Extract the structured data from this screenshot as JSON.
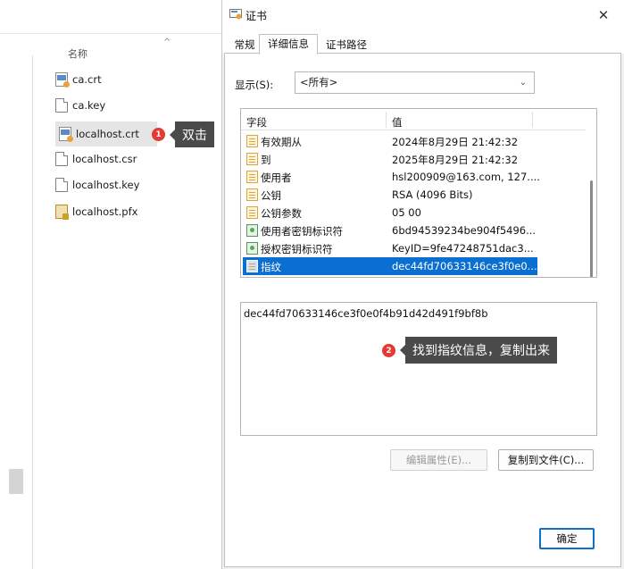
{
  "explorer": {
    "column_name": "名称",
    "files": [
      {
        "name": "ca.crt",
        "icon": "certificate-icon"
      },
      {
        "name": "ca.key",
        "icon": "file-icon"
      },
      {
        "name": "localhost.crt",
        "icon": "certificate-icon"
      },
      {
        "name": "localhost.csr",
        "icon": "file-icon"
      },
      {
        "name": "localhost.key",
        "icon": "file-icon"
      },
      {
        "name": "localhost.pfx",
        "icon": "pfx-icon"
      }
    ]
  },
  "annotations": {
    "step1_number": "1",
    "step1_text": "双击",
    "step2_number": "2",
    "step2_text": "找到指纹信息，复制出来"
  },
  "dialog": {
    "title": "证书",
    "close": "✕",
    "tabs": [
      {
        "label": "常规",
        "active": false
      },
      {
        "label": "详细信息",
        "active": true
      },
      {
        "label": "证书路径",
        "active": false
      }
    ],
    "show_label": "显示(S):",
    "show_value": "<所有>",
    "list_header": {
      "field": "字段",
      "value": "值"
    },
    "rows": [
      {
        "field": "有效期从",
        "value": "2024年8月29日 21:42:32",
        "icon": "orange"
      },
      {
        "field": "到",
        "value": "2025年8月29日 21:42:32",
        "icon": "orange"
      },
      {
        "field": "使用者",
        "value": "hsl200909@163.com, 127....",
        "icon": "orange"
      },
      {
        "field": "公钥",
        "value": "RSA (4096 Bits)",
        "icon": "orange"
      },
      {
        "field": "公钥参数",
        "value": "05 00",
        "icon": "orange"
      },
      {
        "field": "使用者密钥标识符",
        "value": "6bd94539234be904f5496...",
        "icon": "green"
      },
      {
        "field": "授权密钥标识符",
        "value": "KeyID=9fe47248751dac3...",
        "icon": "green"
      },
      {
        "field": "指纹",
        "value": "dec44fd70633146ce3f0e0...",
        "icon": "orange",
        "selected": true
      }
    ],
    "detail_text": "dec44fd70633146ce3f0e0f4b91d42d491f9bf8b",
    "edit_properties": "编辑属性(E)...",
    "copy_to_file": "复制到文件(C)...",
    "ok": "确定"
  },
  "colors": {
    "accent": "#0b6fd1",
    "badge": "#e53935",
    "callout": "#4a4a4a"
  }
}
